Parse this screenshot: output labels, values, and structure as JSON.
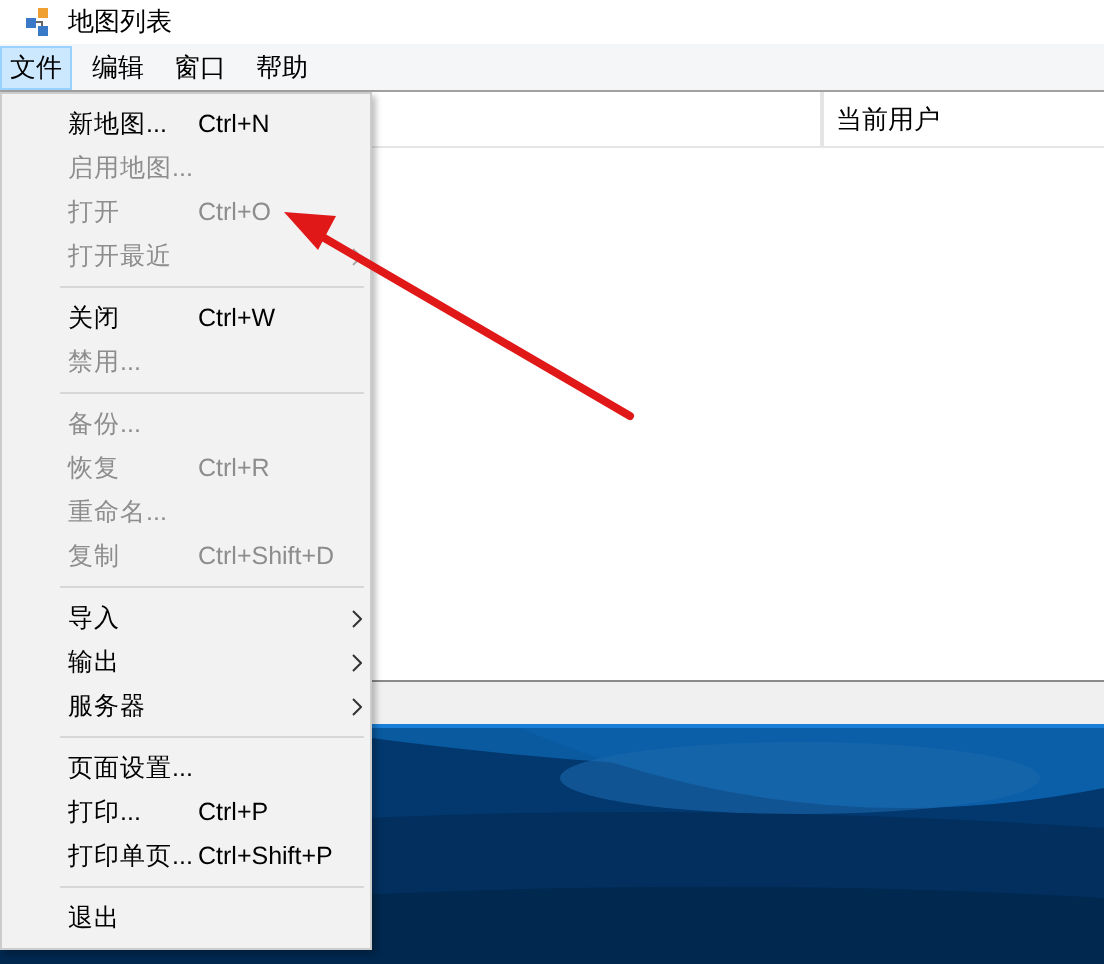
{
  "window": {
    "title": "地图列表"
  },
  "menu_bar": [
    {
      "label": "文件",
      "selected": true
    },
    {
      "label": "编辑",
      "selected": false
    },
    {
      "label": "窗口",
      "selected": false
    },
    {
      "label": "帮助",
      "selected": false
    }
  ],
  "table": {
    "columns": [
      {
        "label": "当前用户"
      }
    ]
  },
  "file_menu": [
    {
      "kind": "item",
      "label": "新地图...",
      "shortcut": "Ctrl+N",
      "disabled": false,
      "submenu": false
    },
    {
      "kind": "item",
      "label": "启用地图...",
      "disabled": true,
      "submenu": false
    },
    {
      "kind": "item",
      "label": "打开",
      "shortcut": "Ctrl+O",
      "disabled": true,
      "submenu": false
    },
    {
      "kind": "item",
      "label": "打开最近",
      "disabled": true,
      "submenu": true
    },
    {
      "kind": "separator"
    },
    {
      "kind": "item",
      "label": "关闭",
      "shortcut": "Ctrl+W",
      "disabled": false,
      "submenu": false
    },
    {
      "kind": "item",
      "label": "禁用...",
      "disabled": true,
      "submenu": false
    },
    {
      "kind": "separator"
    },
    {
      "kind": "item",
      "label": "备份...",
      "disabled": true,
      "submenu": false
    },
    {
      "kind": "item",
      "label": "恢复",
      "shortcut": "Ctrl+R",
      "disabled": true,
      "submenu": false
    },
    {
      "kind": "item",
      "label": "重命名...",
      "disabled": true,
      "submenu": false
    },
    {
      "kind": "item",
      "label": "复制",
      "shortcut": "Ctrl+Shift+D",
      "disabled": true,
      "submenu": false
    },
    {
      "kind": "separator"
    },
    {
      "kind": "item",
      "label": "导入",
      "disabled": false,
      "submenu": true
    },
    {
      "kind": "item",
      "label": "输出",
      "disabled": false,
      "submenu": true
    },
    {
      "kind": "item",
      "label": "服务器",
      "disabled": false,
      "submenu": true
    },
    {
      "kind": "separator"
    },
    {
      "kind": "item",
      "label": "页面设置...",
      "disabled": false,
      "submenu": false
    },
    {
      "kind": "item",
      "label": "打印...",
      "shortcut": "Ctrl+P",
      "disabled": false,
      "submenu": false
    },
    {
      "kind": "item",
      "label": "打印单页...",
      "shortcut": "Ctrl+Shift+P",
      "disabled": false,
      "submenu": false
    },
    {
      "kind": "separator"
    },
    {
      "kind": "item",
      "label": "退出",
      "disabled": false,
      "submenu": false
    }
  ]
}
